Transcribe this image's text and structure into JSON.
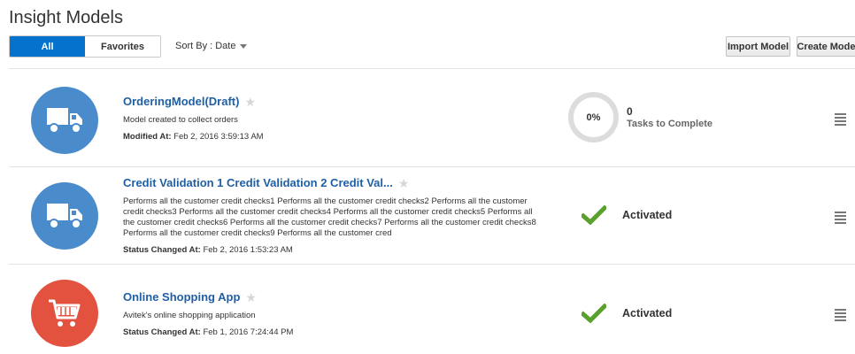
{
  "page": {
    "title": "Insight Models"
  },
  "filters": {
    "all_label": "All",
    "favorites_label": "Favorites"
  },
  "sort": {
    "label": "Sort By : Date"
  },
  "toolbar": {
    "import_label": "Import Model",
    "create_label": "Create Model"
  },
  "colors": {
    "accent": "#0572ce",
    "link": "#1f5fa6",
    "truck_avatar": "#4a8bcc",
    "cart_avatar": "#e3523e",
    "check": "#5aa02c"
  },
  "models": [
    {
      "title": "OrderingModel(Draft)",
      "icon": "truck-icon",
      "description": "Model created to collect orders",
      "meta_label": "Modified At:",
      "meta_value": "Feb 2, 2016 3:59:13 AM",
      "progress": "0%",
      "progress_fraction": 0,
      "tasks_count": "0",
      "tasks_label": "Tasks to Complete"
    },
    {
      "title": "Credit Validation 1 Credit Validation 2 Credit Val...",
      "icon": "truck-icon",
      "description": "Performs all the customer credit checks1 Performs all the customer credit checks2 Performs all the customer credit checks3 Performs all the customer credit checks4 Performs all the customer credit checks5 Performs all the customer credit checks6 Performs all the customer credit checks7 Performs all the customer credit checks8 Performs all the customer credit checks9 Performs all the customer cred",
      "meta_label": "Status Changed At:",
      "meta_value": "Feb 2, 2016 1:53:23 AM",
      "status": "Activated"
    },
    {
      "title": "Online Shopping App",
      "icon": "shopping-cart-icon",
      "description": "Avitek's online shopping application",
      "meta_label": "Status Changed At:",
      "meta_value": "Feb 1, 2016 7:24:44 PM",
      "status": "Activated"
    }
  ]
}
